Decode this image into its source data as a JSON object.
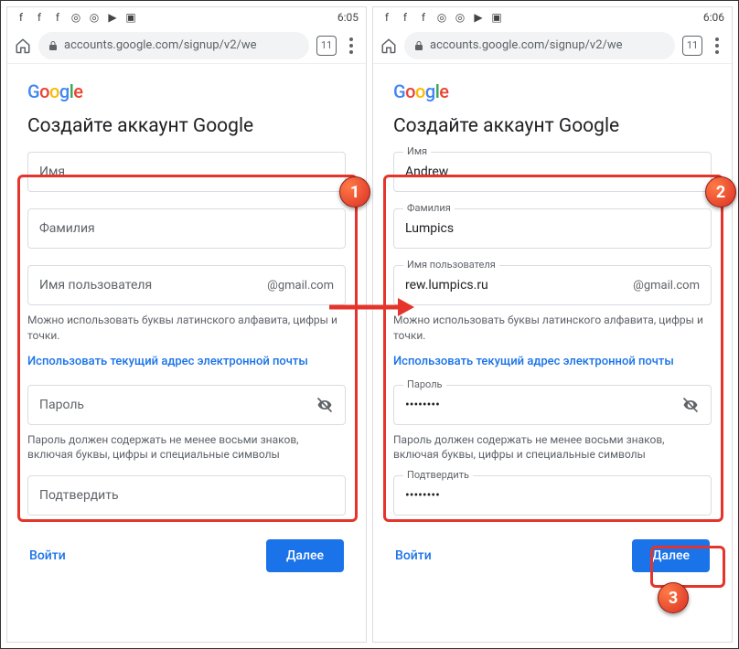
{
  "left": {
    "status": {
      "time": "6:05"
    },
    "browser": {
      "url": "accounts.google.com/signup/v2/we",
      "tab_count": "11"
    },
    "page": {
      "logo": "Google",
      "title": "Создайте аккаунт Google",
      "first_name_label": "Имя",
      "first_name_value": "",
      "last_name_label": "Фамилия",
      "last_name_value": "",
      "username_label": "Имя пользователя",
      "username_value": "",
      "username_suffix": "@gmail.com",
      "username_helper": "Можно использовать буквы латинского алфавита, цифры и точки.",
      "use_existing_link": "Использовать текущий адрес электронной почты",
      "password_label": "Пароль",
      "password_value": "",
      "password_helper": "Пароль должен содержать не менее восьми знаков, включая буквы, цифры и специальные символы",
      "confirm_label": "Подтвердить",
      "confirm_value": "",
      "signin_label": "Войти",
      "next_label": "Далее"
    }
  },
  "right": {
    "status": {
      "time": "6:06"
    },
    "browser": {
      "url": "accounts.google.com/signup/v2/we",
      "tab_count": "11"
    },
    "page": {
      "logo": "Google",
      "title": "Создайте аккаунт Google",
      "first_name_label": "Имя",
      "first_name_value": "Andrew",
      "last_name_label": "Фамилия",
      "last_name_value": "Lumpics",
      "username_label": "Имя пользователя",
      "username_value": "rew.lumpics.ru",
      "username_suffix": "@gmail.com",
      "username_helper": "Можно использовать буквы латинского алфавита, цифры и точки.",
      "use_existing_link": "Использовать текущий адрес электронной почты",
      "password_label": "Пароль",
      "password_value": "••••••••",
      "password_helper": "Пароль должен содержать не менее восьми знаков, включая буквы, цифры и специальные символы",
      "confirm_label": "Подтвердить",
      "confirm_value": "••••••••",
      "signin_label": "Войти",
      "next_label": "Далее"
    }
  },
  "annotations": {
    "badge1": "1",
    "badge2": "2",
    "badge3": "3"
  }
}
